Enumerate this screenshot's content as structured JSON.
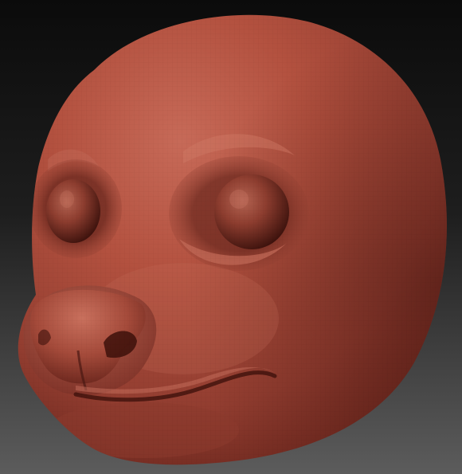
{
  "viewport": {
    "subject": "sculpted-creature-head",
    "material": "clay",
    "colors": {
      "background_top": "#0b0b0b",
      "background_bottom": "#5c5c5c",
      "clay_highlight": "#c76a58",
      "clay_mid": "#a6493a",
      "clay_base": "#8c3a2e",
      "clay_shadow": "#4a1812",
      "clay_deep_shadow": "#2e0d09"
    }
  }
}
